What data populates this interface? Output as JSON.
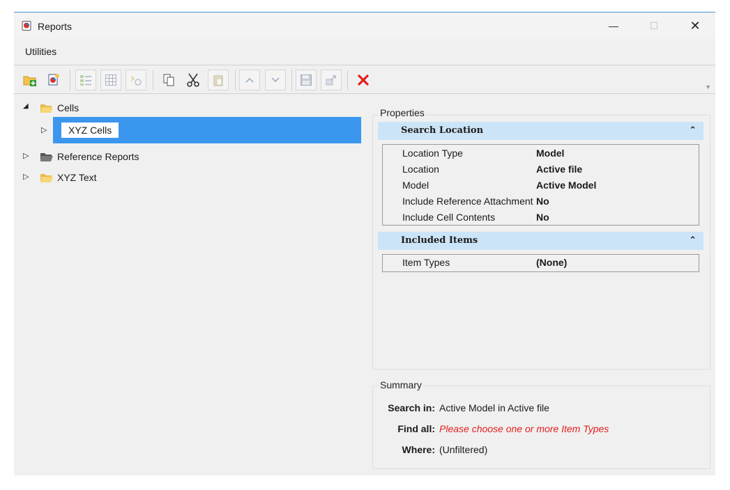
{
  "window": {
    "title": "Reports",
    "controls": {
      "minimize": "—",
      "maximize": "☐",
      "close": "✕"
    }
  },
  "menu": {
    "items": [
      "Utilities"
    ]
  },
  "toolbar": {
    "buttons": [
      "new-folder-icon",
      "new-report-icon",
      "list-view-icon",
      "table-view-icon",
      "filter-icon",
      "copy-icon",
      "cut-icon",
      "paste-icon",
      "move-up-icon",
      "move-down-icon",
      "save-icon",
      "export-icon",
      "delete-icon"
    ],
    "accent_delete": "#e51d1d"
  },
  "tree": {
    "nodes": [
      {
        "label": "Cells",
        "expanded": true,
        "children": [
          {
            "label": "XYZ Cells",
            "selected": true
          }
        ]
      },
      {
        "label": "Reference Reports",
        "expanded": false
      },
      {
        "label": "XYZ Text",
        "expanded": false
      }
    ],
    "selection_color": "#3b97ee"
  },
  "properties": {
    "caption": "Properties",
    "sections": [
      {
        "title": "Search Location",
        "rows": [
          {
            "name": "Location Type",
            "value": "Model"
          },
          {
            "name": "Location",
            "value": "Active file"
          },
          {
            "name": "Model",
            "value": "Active Model"
          },
          {
            "name": "Include Reference Attachments",
            "value": "No"
          },
          {
            "name": "Include Cell Contents",
            "value": "No"
          }
        ]
      },
      {
        "title": "Included Items",
        "rows": [
          {
            "name": "Item Types",
            "value": "(None)"
          }
        ]
      }
    ],
    "header_color": "#cce4f7"
  },
  "summary": {
    "caption": "Summary",
    "rows": [
      {
        "key": "Search in:",
        "value": "Active Model  in Active file",
        "warning": false
      },
      {
        "key": "Find all:",
        "value": "Please choose one or more Item Types",
        "warning": true
      },
      {
        "key": "Where:",
        "value": "(Unfiltered)",
        "warning": false
      }
    ]
  }
}
